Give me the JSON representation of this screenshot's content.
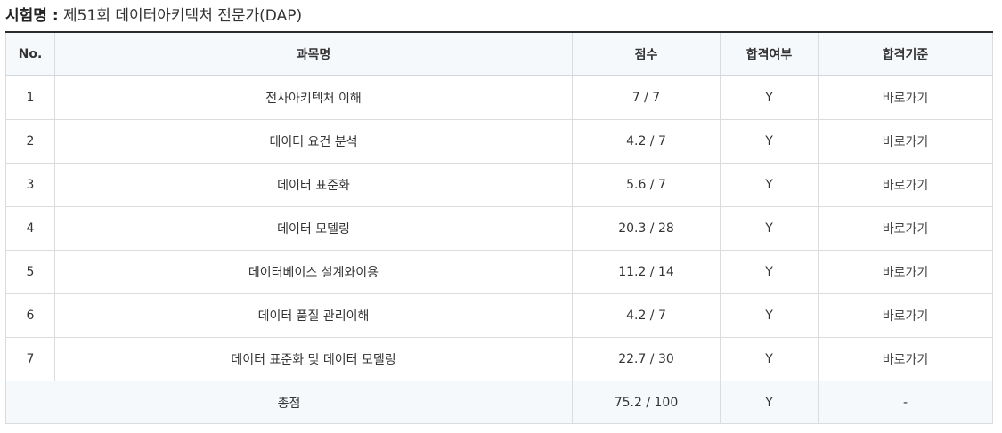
{
  "exam": {
    "label": "시험명 :",
    "name": "제51회 데이터아키텍처 전문가(DAP)"
  },
  "table": {
    "headers": {
      "no": "No.",
      "subject": "과목명",
      "score": "점수",
      "pass": "합격여부",
      "criteria": "합격기준"
    },
    "rows": [
      {
        "no": "1",
        "subject": "전사아키텍처 이해",
        "score": "7 / 7",
        "pass": "Y",
        "criteria": "바로가기"
      },
      {
        "no": "2",
        "subject": "데이터 요건 분석",
        "score": "4.2 / 7",
        "pass": "Y",
        "criteria": "바로가기"
      },
      {
        "no": "3",
        "subject": "데이터 표준화",
        "score": "5.6 / 7",
        "pass": "Y",
        "criteria": "바로가기"
      },
      {
        "no": "4",
        "subject": "데이터 모델링",
        "score": "20.3 / 28",
        "pass": "Y",
        "criteria": "바로가기"
      },
      {
        "no": "5",
        "subject": "데이터베이스 설계와이용",
        "score": "11.2 / 14",
        "pass": "Y",
        "criteria": "바로가기"
      },
      {
        "no": "6",
        "subject": "데이터 품질 관리이해",
        "score": "4.2 / 7",
        "pass": "Y",
        "criteria": "바로가기"
      },
      {
        "no": "7",
        "subject": "데이터 표준화 및 데이터 모델링",
        "score": "22.7 / 30",
        "pass": "Y",
        "criteria": "바로가기"
      }
    ],
    "total": {
      "label": "총점",
      "score": "75.2 / 100",
      "pass": "Y",
      "criteria": "-"
    }
  }
}
